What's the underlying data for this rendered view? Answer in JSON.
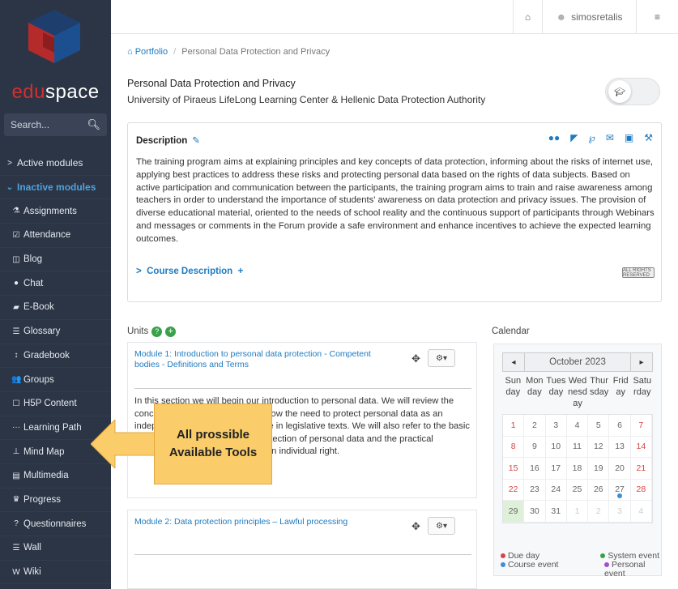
{
  "sidebar": {
    "logo_red": "edu",
    "logo_rest": "space",
    "search_placeholder": "Search...",
    "search_button": "Q",
    "sections": [
      {
        "label": "Active modules"
      },
      {
        "label": "Inactive modules"
      }
    ],
    "items": [
      {
        "label": "Assignments",
        "icon": "flask-icon",
        "glyph": "⚗"
      },
      {
        "label": "Attendance",
        "icon": "checkbox-icon",
        "glyph": "☑"
      },
      {
        "label": "Blog",
        "icon": "columns-icon",
        "glyph": "◫"
      },
      {
        "label": "Chat",
        "icon": "chat-icon",
        "glyph": "●"
      },
      {
        "label": "E-Book",
        "icon": "book-icon",
        "glyph": "▰"
      },
      {
        "label": "Glossary",
        "icon": "list-icon",
        "glyph": "☰"
      },
      {
        "label": "Gradebook",
        "icon": "sort-icon",
        "glyph": "↕"
      },
      {
        "label": "Groups",
        "icon": "users-icon",
        "glyph": "👥"
      },
      {
        "label": "H5P Content",
        "icon": "square-icon",
        "glyph": "☐"
      },
      {
        "label": "Learning Path",
        "icon": "ellipsis-icon",
        "glyph": "···"
      },
      {
        "label": "Mind Map",
        "icon": "sitemap-icon",
        "glyph": "⊥"
      },
      {
        "label": "Multimedia",
        "icon": "film-icon",
        "glyph": "▤"
      },
      {
        "label": "Progress",
        "icon": "trophy-icon",
        "glyph": "♛"
      },
      {
        "label": "Questionnaires",
        "icon": "question-icon",
        "glyph": "?"
      },
      {
        "label": "Wall",
        "icon": "wall-icon",
        "glyph": "☰"
      },
      {
        "label": "Wiki",
        "icon": "wikipedia-icon",
        "glyph": "W"
      }
    ]
  },
  "topbar": {
    "username": "simosretalis"
  },
  "breadcrumb": {
    "root": "Portfolio",
    "separator": "/",
    "current": "Personal Data Protection and Privacy"
  },
  "course": {
    "title": "Personal Data Protection and Privacy",
    "subtitle": "University of Piraeus LifeLong Learning Center & Hellenic Data Protection Authority"
  },
  "description": {
    "heading": "Description",
    "text": "The training program aims at explaining principles and key concepts of data protection, informing about the risks of internet use, applying best practices to address these risks and protecting personal data based on the rights of data subjects. Based on active participation and communication between the participants, the training program aims to train and raise awareness among teachers in order to understand the importance of students' awareness on data protection and privacy issues. The provision of diverse educational material, oriented to the needs of school reality and the continuous support of participants through Webinars and messages or comments in the Forum provide a safe environment and enhance incentives to achieve the expected learning outcomes.",
    "course_description_link": "Course Description",
    "license": "ALL RIGHTS RESERVED"
  },
  "units": {
    "heading": "Units",
    "list": [
      {
        "title": "Module 1: Introduction to personal data protection - Competent bodies - Definitions and Terms",
        "text": "In this section we will begin our introduction to personal data. We will review the concepts of privacy and analyse how the need to protect personal data as an independent (separate) right arose in legislative texts. We will also refer to the basic principles, which establish the protection of personal data and the practical importance of their protection as an individual right."
      },
      {
        "title": "Module 2: Data protection principles – Lawful processing",
        "text": ""
      }
    ]
  },
  "calendar": {
    "heading": "Calendar",
    "month": "October 2023",
    "prev": "◂",
    "next": "▸",
    "weekdays": [
      "Sun day",
      "Mon day",
      "Tues day",
      "Wed nesd ay",
      "Thur sday",
      "Frid ay",
      "Satu rday"
    ],
    "days": [
      {
        "n": "1",
        "cls": "weekend"
      },
      {
        "n": "2",
        "cls": ""
      },
      {
        "n": "3",
        "cls": ""
      },
      {
        "n": "4",
        "cls": ""
      },
      {
        "n": "5",
        "cls": ""
      },
      {
        "n": "6",
        "cls": ""
      },
      {
        "n": "7",
        "cls": "weekend"
      },
      {
        "n": "8",
        "cls": "weekend"
      },
      {
        "n": "9",
        "cls": ""
      },
      {
        "n": "10",
        "cls": ""
      },
      {
        "n": "11",
        "cls": ""
      },
      {
        "n": "12",
        "cls": ""
      },
      {
        "n": "13",
        "cls": ""
      },
      {
        "n": "14",
        "cls": "weekend"
      },
      {
        "n": "15",
        "cls": "weekend"
      },
      {
        "n": "16",
        "cls": ""
      },
      {
        "n": "17",
        "cls": ""
      },
      {
        "n": "18",
        "cls": ""
      },
      {
        "n": "19",
        "cls": ""
      },
      {
        "n": "20",
        "cls": ""
      },
      {
        "n": "21",
        "cls": "weekend"
      },
      {
        "n": "22",
        "cls": "weekend"
      },
      {
        "n": "23",
        "cls": ""
      },
      {
        "n": "24",
        "cls": ""
      },
      {
        "n": "25",
        "cls": ""
      },
      {
        "n": "26",
        "cls": ""
      },
      {
        "n": "27",
        "cls": "event"
      },
      {
        "n": "28",
        "cls": "weekend"
      },
      {
        "n": "29",
        "cls": "today"
      },
      {
        "n": "30",
        "cls": ""
      },
      {
        "n": "31",
        "cls": ""
      },
      {
        "n": "1",
        "cls": "muted"
      },
      {
        "n": "2",
        "cls": "muted"
      },
      {
        "n": "3",
        "cls": "muted"
      },
      {
        "n": "4",
        "cls": "muted"
      }
    ],
    "legend": [
      {
        "label": "Due day",
        "color": "#d94343"
      },
      {
        "label": "System event",
        "color": "#3aa14b"
      },
      {
        "label": "Course event",
        "color": "#3a8fd8"
      },
      {
        "label": "Personal event",
        "color": "#a04fd0"
      }
    ]
  },
  "callout": {
    "line1": "All prossible",
    "line2": "Available Tools"
  }
}
